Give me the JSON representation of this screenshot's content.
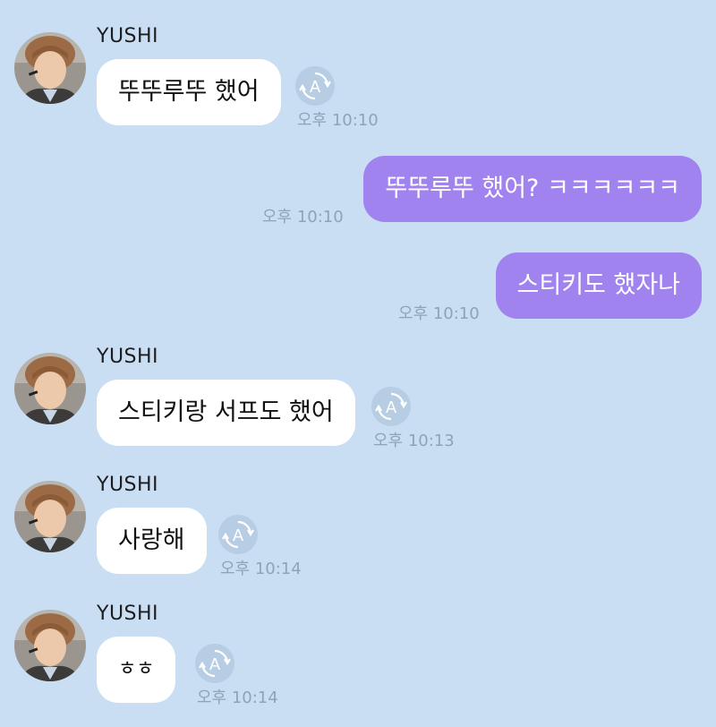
{
  "colors": {
    "background": "#c9def3",
    "incoming_bubble": "#ffffff",
    "outgoing_bubble": "#a083ee",
    "timestamp": "#8fa3b8",
    "translate_button": "#b7cde3"
  },
  "messages": [
    {
      "direction": "in",
      "sender": "YUSHI",
      "text": "뚜뚜루뚜 했어",
      "time": "오후 10:10",
      "icon": "translate-icon"
    },
    {
      "direction": "out",
      "text": "뚜뚜루뚜 했어? ㅋㅋㅋㅋㅋㅋ",
      "time": "오후 10:10"
    },
    {
      "direction": "out",
      "text": "스티키도 했자나",
      "time": "오후 10:10"
    },
    {
      "direction": "in",
      "sender": "YUSHI",
      "text": "스티키랑 서프도 했어",
      "time": "오후 10:13",
      "icon": "translate-icon"
    },
    {
      "direction": "in",
      "sender": "YUSHI",
      "text": "사랑해",
      "time": "오후 10:14",
      "icon": "translate-icon"
    },
    {
      "direction": "in",
      "sender": "YUSHI",
      "text": "ㅎㅎ",
      "time": "오후 10:14",
      "icon": "translate-icon"
    }
  ]
}
